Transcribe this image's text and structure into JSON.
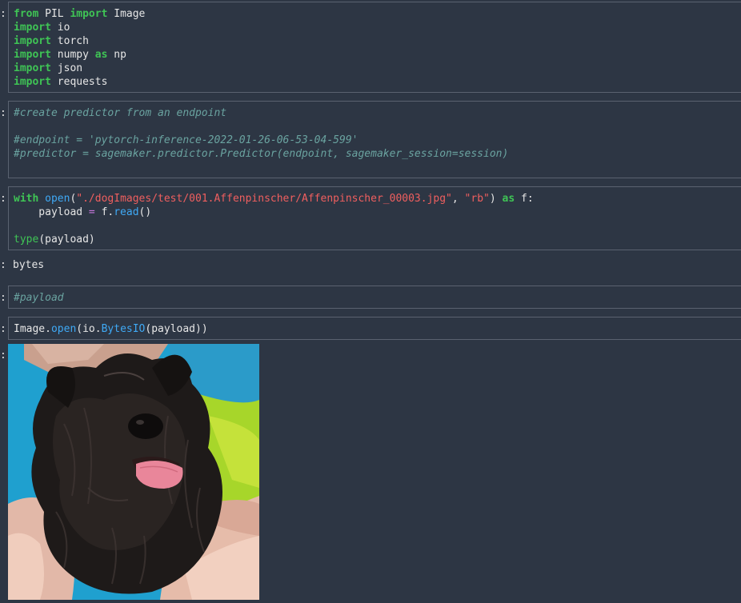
{
  "prompts": [
    ":",
    ":",
    ":",
    ":",
    ":",
    ":",
    ":"
  ],
  "cell1": {
    "l1a": "from",
    "l1b": " PIL ",
    "l1c": "import",
    "l1d": " Image",
    "l2a": "import",
    "l2b": " io",
    "l3a": "import",
    "l3b": " torch",
    "l4a": "import",
    "l4b": " numpy ",
    "l4c": "as",
    "l4d": " np",
    "l5a": "import",
    "l5b": " json",
    "l6a": "import",
    "l6b": " requests"
  },
  "cell2": {
    "c1": "#create predictor from an endpoint",
    "c2": "#endpoint = 'pytorch-inference-2022-01-26-06-53-04-599'",
    "c3": "#predictor = sagemaker.predictor.Predictor(endpoint, sagemaker_session=session)"
  },
  "cell3": {
    "a": "with",
    "b": " ",
    "c": "open",
    "d": "(",
    "e": "\"./dogImages/test/001.Affenpinscher/Affenpinscher_00003.jpg\"",
    "f": ", ",
    "g": "\"rb\"",
    "h": ") ",
    "i": "as",
    "j": " f:",
    "k": "    payload ",
    "l": "=",
    "m": " f.",
    "n": "read",
    "o": "()",
    "p": "type",
    "q": "(payload)"
  },
  "output1": "bytes",
  "cell4": {
    "c": "#payload"
  },
  "cell5": {
    "a": "Image.",
    "b": "open",
    "c": "(io.",
    "d": "BytesIO",
    "e": "(payload))"
  }
}
